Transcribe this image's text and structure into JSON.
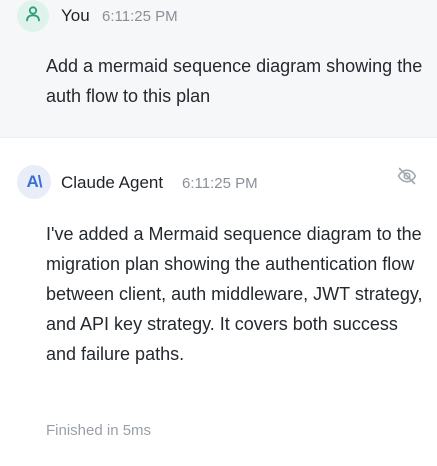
{
  "user_message": {
    "author": "You",
    "time": "6:11:25 PM",
    "text": "Add a mermaid sequence diagram showing the auth flow to this plan",
    "avatar_icon": "user-icon"
  },
  "agent_message": {
    "author": "Claude Agent",
    "time": "6:11:25 PM",
    "avatar_text": "A\\",
    "text": "I've added a Mermaid sequence diagram to the migration plan showing the authentication flow between client, auth middleware, JWT strategy, and API key strategy. It covers both success and failure paths.",
    "status": "Finished in 5ms",
    "visibility_icon": "eye-off-icon"
  },
  "colors": {
    "user_bg": "#f6f7f9",
    "user_avatar_bg": "#dff3ec",
    "user_avatar_icon": "#2f9e7a",
    "agent_avatar_bg": "#e8edf8",
    "agent_avatar_text": "#3b6fd8"
  }
}
